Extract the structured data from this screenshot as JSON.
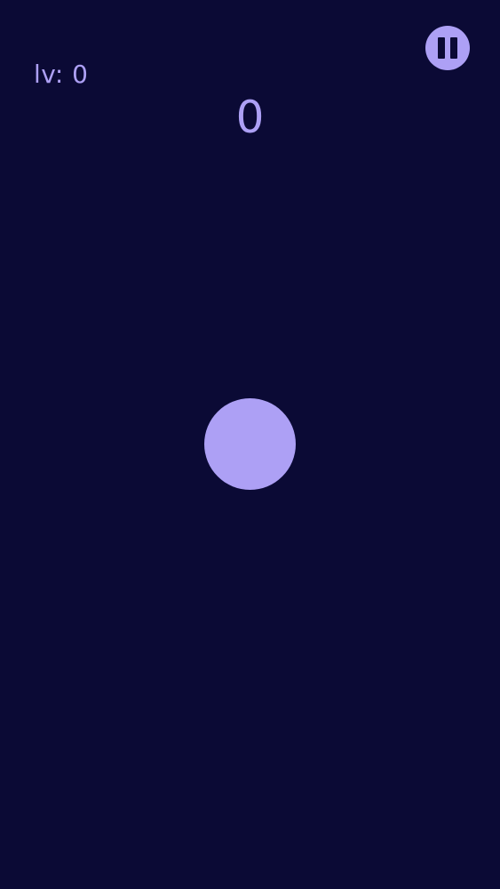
{
  "hud": {
    "level_text": "lv: 0",
    "score_text": "0",
    "pause_icon": "pause-icon"
  },
  "colors": {
    "background": "#0b0a35",
    "accent": "#ada0f5"
  }
}
